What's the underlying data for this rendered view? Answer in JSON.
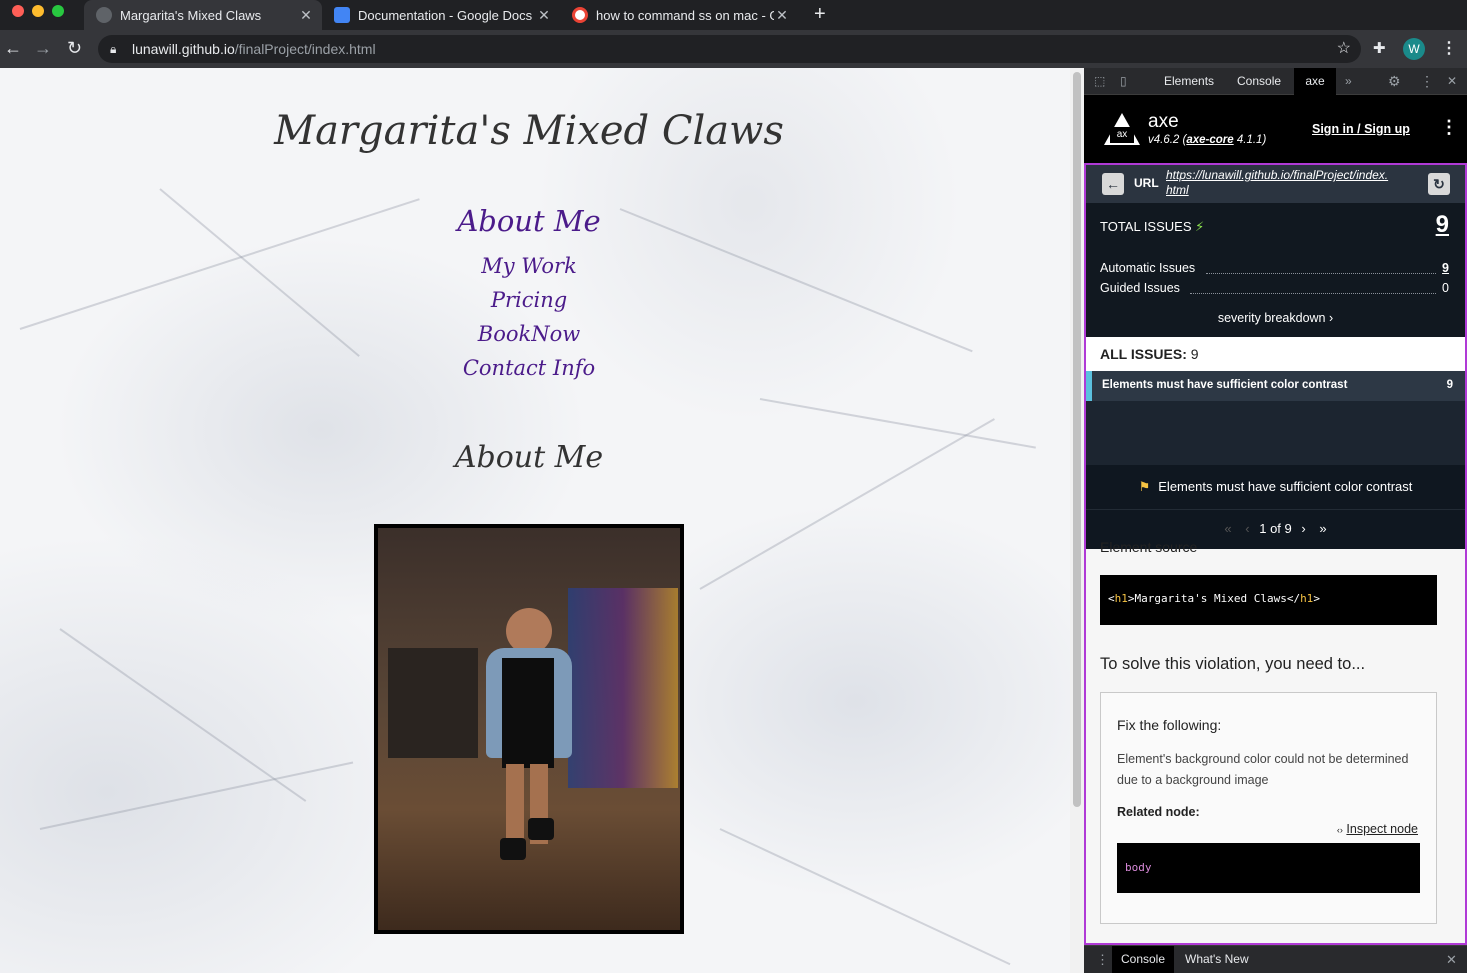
{
  "tabs": [
    {
      "title": "Margarita's Mixed Claws",
      "active": true
    },
    {
      "title": "Documentation - Google Docs",
      "active": false
    },
    {
      "title": "how to command ss on mac - G",
      "active": false
    }
  ],
  "toolbar": {
    "url_host": "lunawill.github.io",
    "url_path": "/finalProject/index.html",
    "avatar_letter": "W"
  },
  "page": {
    "title": "Margarita's Mixed Claws",
    "nav": [
      "About Me",
      "My Work",
      "Pricing",
      "BookNow",
      "Contact Info"
    ],
    "section_heading": "About Me"
  },
  "devtools": {
    "tabs": [
      "Elements",
      "Console",
      "axe"
    ],
    "axe": {
      "name": "axe",
      "version": "v4.6.2",
      "core_link": "axe-core",
      "core_version": "4.1.1",
      "sign_in": "Sign in / Sign up",
      "url_label": "URL",
      "url": "https://lunawill.github.io/finalProject/index.html",
      "url_line1": "https://lunawill.github.io/finalProject/index.",
      "url_line2": "html",
      "total_label": "TOTAL ISSUES",
      "total": "9",
      "automatic_label": "Automatic Issues",
      "automatic": "9",
      "guided_label": "Guided Issues",
      "guided": "0",
      "severity": "severity breakdown",
      "all_issues_label": "ALL ISSUES:",
      "all_issues_count": "9",
      "issue_title": "Elements must have sufficient color contrast",
      "issue_count": "9",
      "detail_title": "Elements must have sufficient color contrast",
      "pager": "1 of 9",
      "element_source_label": "Element source",
      "element_source_open": "<",
      "element_source_tag1": "h1",
      "element_source_mid": ">Margarita's Mixed Claws</",
      "element_source_tag2": "h1",
      "element_source_close": ">",
      "solve_heading": "To solve this violation, you need to...",
      "fix_heading": "Fix the following:",
      "fix_text": "Element's background color could not be determined due to a background image",
      "related_node": "Related node:",
      "inspect_node": "Inspect node",
      "node_value": "body"
    },
    "bottom_tabs": [
      "Console",
      "What's New"
    ]
  },
  "colors": {
    "accent_purple": "#b03ad6",
    "nav_link": "#4b1b8a",
    "issue_marker": "#5bc0de",
    "total_icon": "#8be04e"
  }
}
